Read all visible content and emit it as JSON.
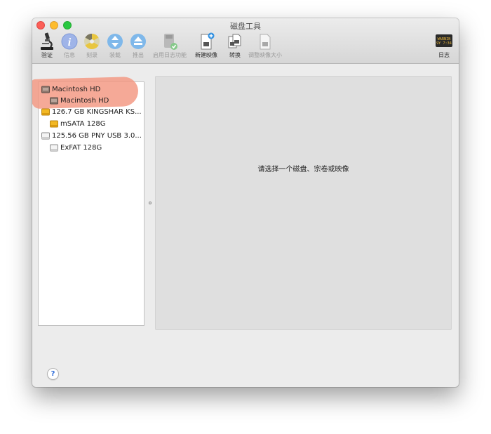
{
  "window": {
    "title": "磁盘工具"
  },
  "toolbar": {
    "items": [
      {
        "label": "验证",
        "icon": "microscope-icon",
        "enabled": true
      },
      {
        "label": "信息",
        "icon": "info-icon",
        "enabled": false
      },
      {
        "label": "刻录",
        "icon": "burn-icon",
        "enabled": false
      },
      {
        "label": "装载",
        "icon": "mount-icon",
        "enabled": false
      },
      {
        "label": "推出",
        "icon": "eject-icon",
        "enabled": false
      },
      {
        "label": "启用日志功能",
        "icon": "journal-disk-icon",
        "enabled": false
      },
      {
        "label": "新建映像",
        "icon": "new-image-icon",
        "enabled": true
      },
      {
        "label": "转换",
        "icon": "convert-icon",
        "enabled": true
      },
      {
        "label": "调整映像大小",
        "icon": "resize-image-icon",
        "enabled": false
      },
      {
        "label": "日志",
        "icon": "log-icon",
        "enabled": true,
        "icon_text": [
          "WARNIN",
          "9Y 7:34"
        ]
      }
    ]
  },
  "sidebar": {
    "items": [
      {
        "label": "Macintosh HD",
        "level": 0,
        "icon": "internal-disk-icon"
      },
      {
        "label": "Macintosh HD",
        "level": 1,
        "icon": "internal-disk-icon"
      },
      {
        "label": "126.7 GB KINGSHAR KS...",
        "level": 0,
        "icon": "external-disk-icon"
      },
      {
        "label": "mSATA 128G",
        "level": 1,
        "icon": "external-disk-icon"
      },
      {
        "label": "125.56 GB PNY USB 3.0...",
        "level": 0,
        "icon": "usb-disk-icon"
      },
      {
        "label": "ExFAT 128G",
        "level": 1,
        "icon": "usb-disk-icon"
      }
    ]
  },
  "content": {
    "placeholder": "请选择一个磁盘、宗卷或映像"
  },
  "help": {
    "label": "?"
  },
  "colors": {
    "highlight": "#f39680",
    "close": "#fc5f57",
    "minimize": "#fdbc2e",
    "zoom": "#28c840",
    "accent": "#2d6bd8"
  }
}
